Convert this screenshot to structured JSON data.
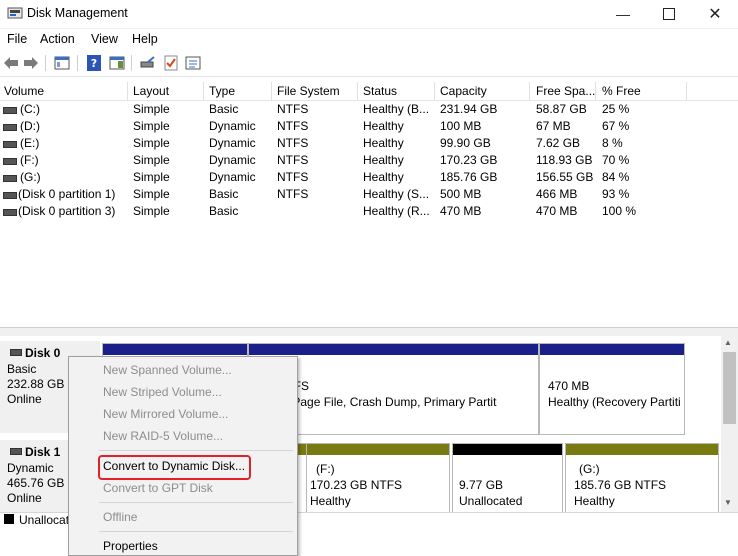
{
  "window": {
    "title": "Disk Management",
    "icons": {
      "app": "disk-management-icon"
    }
  },
  "menu": [
    "File",
    "Action",
    "View",
    "Help"
  ],
  "toolbar": [
    "back-icon",
    "forward-icon",
    "console-tree-icon",
    "help-icon",
    "help-pane-icon",
    "rescan-icon",
    "check-icon",
    "properties-icon"
  ],
  "table": {
    "headers": [
      "Volume",
      "Layout",
      "Type",
      "File System",
      "Status",
      "Capacity",
      "Free Spa...",
      "% Free"
    ],
    "rows": [
      [
        "(C:)",
        "Simple",
        "Basic",
        "NTFS",
        "Healthy (B...",
        "231.94 GB",
        "58.87 GB",
        "25 %"
      ],
      [
        "(D:)",
        "Simple",
        "Dynamic",
        "NTFS",
        "Healthy",
        "100 MB",
        "67 MB",
        "67 %"
      ],
      [
        "(E:)",
        "Simple",
        "Dynamic",
        "NTFS",
        "Healthy",
        "99.90 GB",
        "7.62 GB",
        "8 %"
      ],
      [
        "(F:)",
        "Simple",
        "Dynamic",
        "NTFS",
        "Healthy",
        "170.23 GB",
        "118.93 GB",
        "70 %"
      ],
      [
        "(G:)",
        "Simple",
        "Dynamic",
        "NTFS",
        "Healthy",
        "185.76 GB",
        "156.55 GB",
        "84 %"
      ],
      [
        "(Disk 0 partition 1)",
        "Simple",
        "Basic",
        "NTFS",
        "Healthy (S...",
        "500 MB",
        "466 MB",
        "93 %"
      ],
      [
        "(Disk 0 partition 3)",
        "Simple",
        "Basic",
        "",
        "Healthy (R...",
        "470 MB",
        "470 MB",
        "100 %"
      ]
    ]
  },
  "disks": [
    {
      "name": "Disk 0",
      "type": "Basic",
      "size": "232.88 GB",
      "state": "Online",
      "partitions": [
        {
          "line1": "GB NTFS",
          "line2": "(Boot, Page File, Crash Dump, Primary Partit"
        },
        {
          "line1": "470 MB",
          "line2": "Healthy (Recovery Partiti"
        }
      ]
    },
    {
      "name": "Disk 1",
      "type": "Dynamic",
      "size": "465.76 GB",
      "state": "Online",
      "partitions": [
        {
          "line0": "(F:)",
          "line1": "170.23 GB NTFS",
          "line2": "Healthy"
        },
        {
          "line1": "9.77 GB",
          "line2": "Unallocated"
        },
        {
          "line0": "(G:)",
          "line1": "185.76 GB NTFS",
          "line2": "Healthy"
        }
      ]
    }
  ],
  "legend": {
    "unallocated": "Unallocated"
  },
  "context_menu": {
    "items": [
      {
        "label": "New Spanned Volume...",
        "enabled": false
      },
      {
        "label": "New Striped Volume...",
        "enabled": false
      },
      {
        "label": "New Mirrored Volume...",
        "enabled": false
      },
      {
        "label": "New RAID-5 Volume...",
        "enabled": false
      },
      {
        "label": "Convert to Dynamic Disk...",
        "enabled": true,
        "highlighted": true
      },
      {
        "label": "Convert to GPT Disk",
        "enabled": false
      },
      {
        "label": "Offline",
        "enabled": false
      },
      {
        "label": "Properties",
        "enabled": true
      }
    ]
  },
  "colors": {
    "primary_bar": "#1b1f8a",
    "unallocated_bar": "#000000",
    "simple_volume_bar": "#7a7a12",
    "highlight": "#e2212a"
  }
}
